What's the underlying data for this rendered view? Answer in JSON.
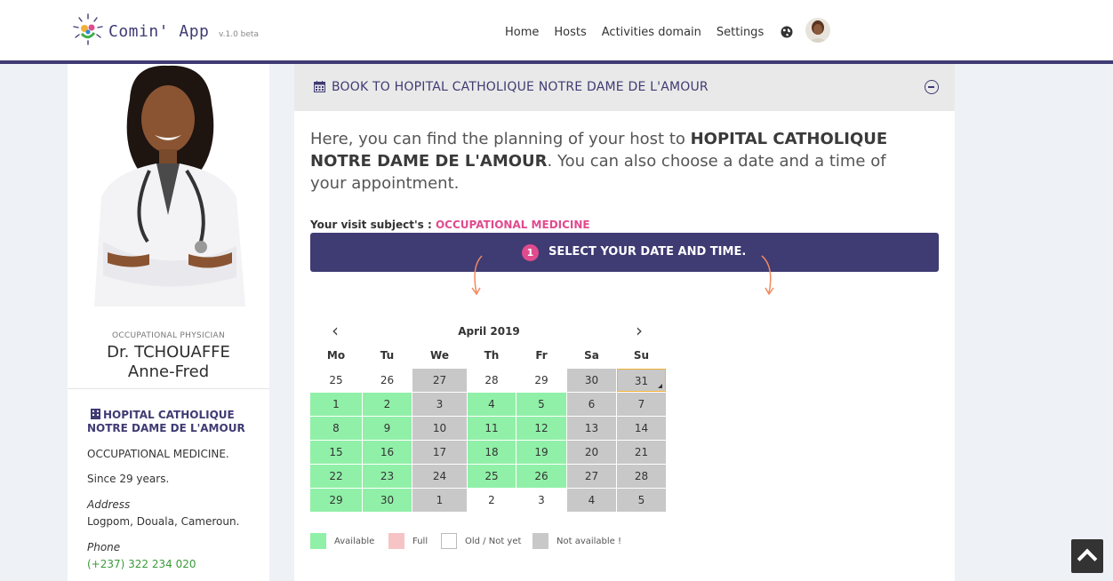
{
  "header": {
    "brand": "Comin' App",
    "version": "v.1.0 beta",
    "nav": [
      "Home",
      "Hosts",
      "Activities domain",
      "Settings"
    ]
  },
  "profile": {
    "specialty": "OCCUPATIONAL PHYSICIAN",
    "name_line1": "Dr. TCHOUAFFE",
    "name_line2": "Anne-Fred",
    "hospital": "HOPITAL CATHOLIQUE NOTRE DAME DE L'AMOUR",
    "domain": "OCCUPATIONAL MEDICINE.",
    "experience": "Since 29 years.",
    "address_label": "Address",
    "address": "Logpom, Douala, Cameroun.",
    "phone_label": "Phone",
    "phone": "(+237) 322 234 020"
  },
  "panel": {
    "title": "BOOK TO HOPITAL CATHOLIQUE NOTRE DAME DE L'AMOUR",
    "intro_prefix": "Here, you can find the planning of your host to ",
    "intro_host": "HOPITAL CATHOLIQUE NOTRE DAME DE L'AMOUR",
    "intro_suffix": ". You can also choose a date and a time of your appointment.",
    "subject_label": "Your visit subject's : ",
    "subject_value": "OCCUPATIONAL MEDICINE",
    "step_number": "1",
    "step_text": "SELECT YOUR DATE AND TIME."
  },
  "calendar": {
    "month": "April 2019",
    "prev": "‹",
    "next": "›",
    "weekdays": [
      "Mo",
      "Tu",
      "We",
      "Th",
      "Fr",
      "Sa",
      "Su"
    ],
    "weeks": [
      [
        {
          "d": "25",
          "s": "old"
        },
        {
          "d": "26",
          "s": "old"
        },
        {
          "d": "27",
          "s": "na"
        },
        {
          "d": "28",
          "s": "old"
        },
        {
          "d": "29",
          "s": "old"
        },
        {
          "d": "30",
          "s": "na"
        },
        {
          "d": "31",
          "s": "na",
          "selected": true
        }
      ],
      [
        {
          "d": "1",
          "s": "av"
        },
        {
          "d": "2",
          "s": "av"
        },
        {
          "d": "3",
          "s": "na"
        },
        {
          "d": "4",
          "s": "av"
        },
        {
          "d": "5",
          "s": "av"
        },
        {
          "d": "6",
          "s": "na"
        },
        {
          "d": "7",
          "s": "na"
        }
      ],
      [
        {
          "d": "8",
          "s": "av"
        },
        {
          "d": "9",
          "s": "av"
        },
        {
          "d": "10",
          "s": "na"
        },
        {
          "d": "11",
          "s": "av"
        },
        {
          "d": "12",
          "s": "av"
        },
        {
          "d": "13",
          "s": "na"
        },
        {
          "d": "14",
          "s": "na"
        }
      ],
      [
        {
          "d": "15",
          "s": "av"
        },
        {
          "d": "16",
          "s": "av"
        },
        {
          "d": "17",
          "s": "na"
        },
        {
          "d": "18",
          "s": "av"
        },
        {
          "d": "19",
          "s": "av"
        },
        {
          "d": "20",
          "s": "na"
        },
        {
          "d": "21",
          "s": "na"
        }
      ],
      [
        {
          "d": "22",
          "s": "av"
        },
        {
          "d": "23",
          "s": "av"
        },
        {
          "d": "24",
          "s": "na"
        },
        {
          "d": "25",
          "s": "av"
        },
        {
          "d": "26",
          "s": "av"
        },
        {
          "d": "27",
          "s": "na"
        },
        {
          "d": "28",
          "s": "na"
        }
      ],
      [
        {
          "d": "29",
          "s": "av"
        },
        {
          "d": "30",
          "s": "av"
        },
        {
          "d": "1",
          "s": "na"
        },
        {
          "d": "2",
          "s": "old"
        },
        {
          "d": "3",
          "s": "old"
        },
        {
          "d": "4",
          "s": "na"
        },
        {
          "d": "5",
          "s": "na"
        }
      ]
    ]
  },
  "legend": [
    {
      "label": "Available",
      "color": "#90f0a8"
    },
    {
      "label": "Full",
      "color": "#f6c4c4"
    },
    {
      "label": "Old / Not yet",
      "color": "#ffffff"
    },
    {
      "label": "Not available !",
      "color": "#c8c8c8"
    }
  ]
}
